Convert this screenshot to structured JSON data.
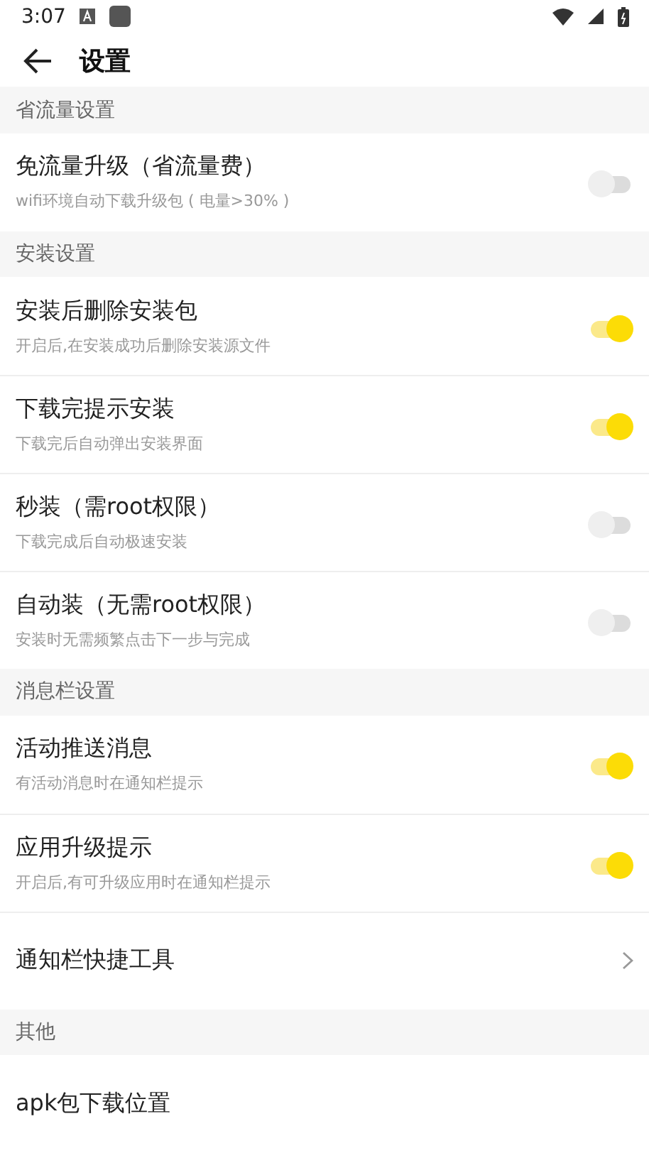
{
  "status_bar": {
    "time": "3:07"
  },
  "app_bar": {
    "title": "设置"
  },
  "sections": [
    {
      "title": "省流量设置",
      "items": [
        {
          "kind": "toggle",
          "title": "免流量升级（省流量费）",
          "subtitle": "wifi环境自动下载升级包 ( 电量>30% )",
          "on": false
        }
      ]
    },
    {
      "title": "安装设置",
      "items": [
        {
          "kind": "toggle",
          "title": "安装后删除安装包",
          "subtitle": "开启后,在安装成功后删除安装源文件",
          "on": true
        },
        {
          "kind": "toggle",
          "title": "下载完提示安装",
          "subtitle": "下载完后自动弹出安装界面",
          "on": true
        },
        {
          "kind": "toggle",
          "title": "秒装（需root权限）",
          "subtitle": "下载完成后自动极速安装",
          "on": false
        },
        {
          "kind": "toggle",
          "title": "自动装（无需root权限）",
          "subtitle": "安装时无需频繁点击下一步与完成",
          "on": false
        }
      ]
    },
    {
      "title": "消息栏设置",
      "items": [
        {
          "kind": "toggle",
          "title": "活动推送消息",
          "subtitle": "有活动消息时在通知栏提示",
          "on": true
        },
        {
          "kind": "toggle",
          "title": "应用升级提示",
          "subtitle": "开启后,有可升级应用时在通知栏提示",
          "on": true
        },
        {
          "kind": "link",
          "title": "通知栏快捷工具"
        }
      ]
    },
    {
      "title": "其他",
      "items": [
        {
          "kind": "text",
          "title": "apk包下载位置"
        }
      ]
    }
  ]
}
